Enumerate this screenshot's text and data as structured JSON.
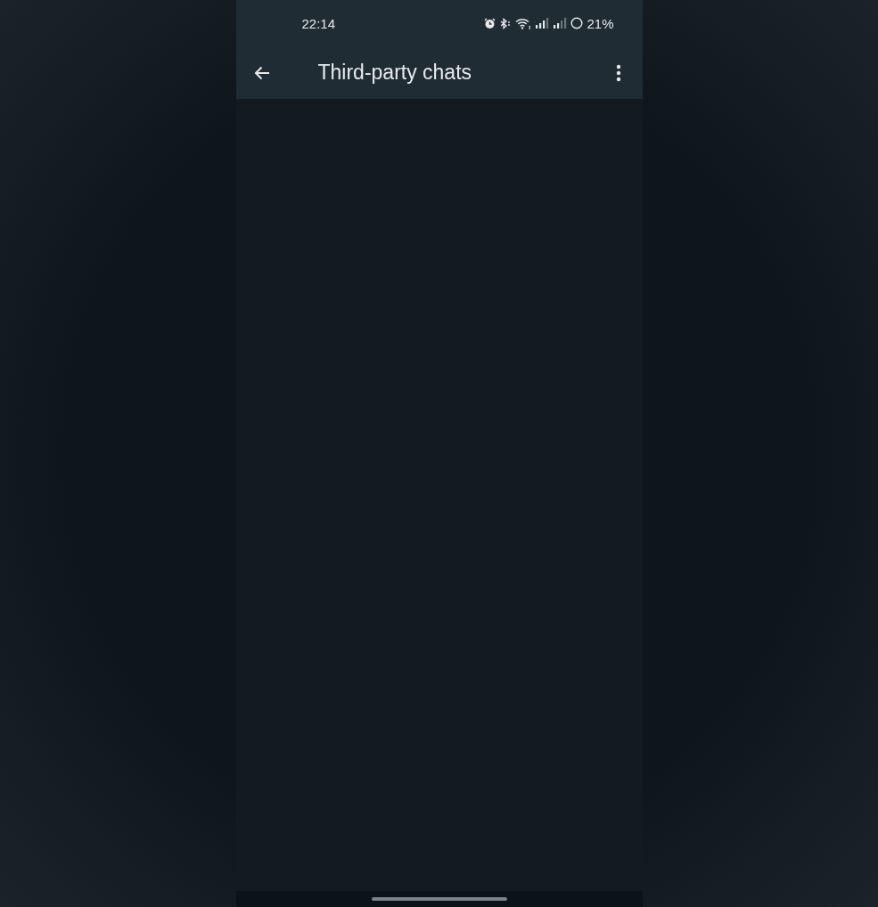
{
  "status_bar": {
    "time": "22:14",
    "battery": "21%"
  },
  "app_bar": {
    "title": "Third-party chats"
  }
}
